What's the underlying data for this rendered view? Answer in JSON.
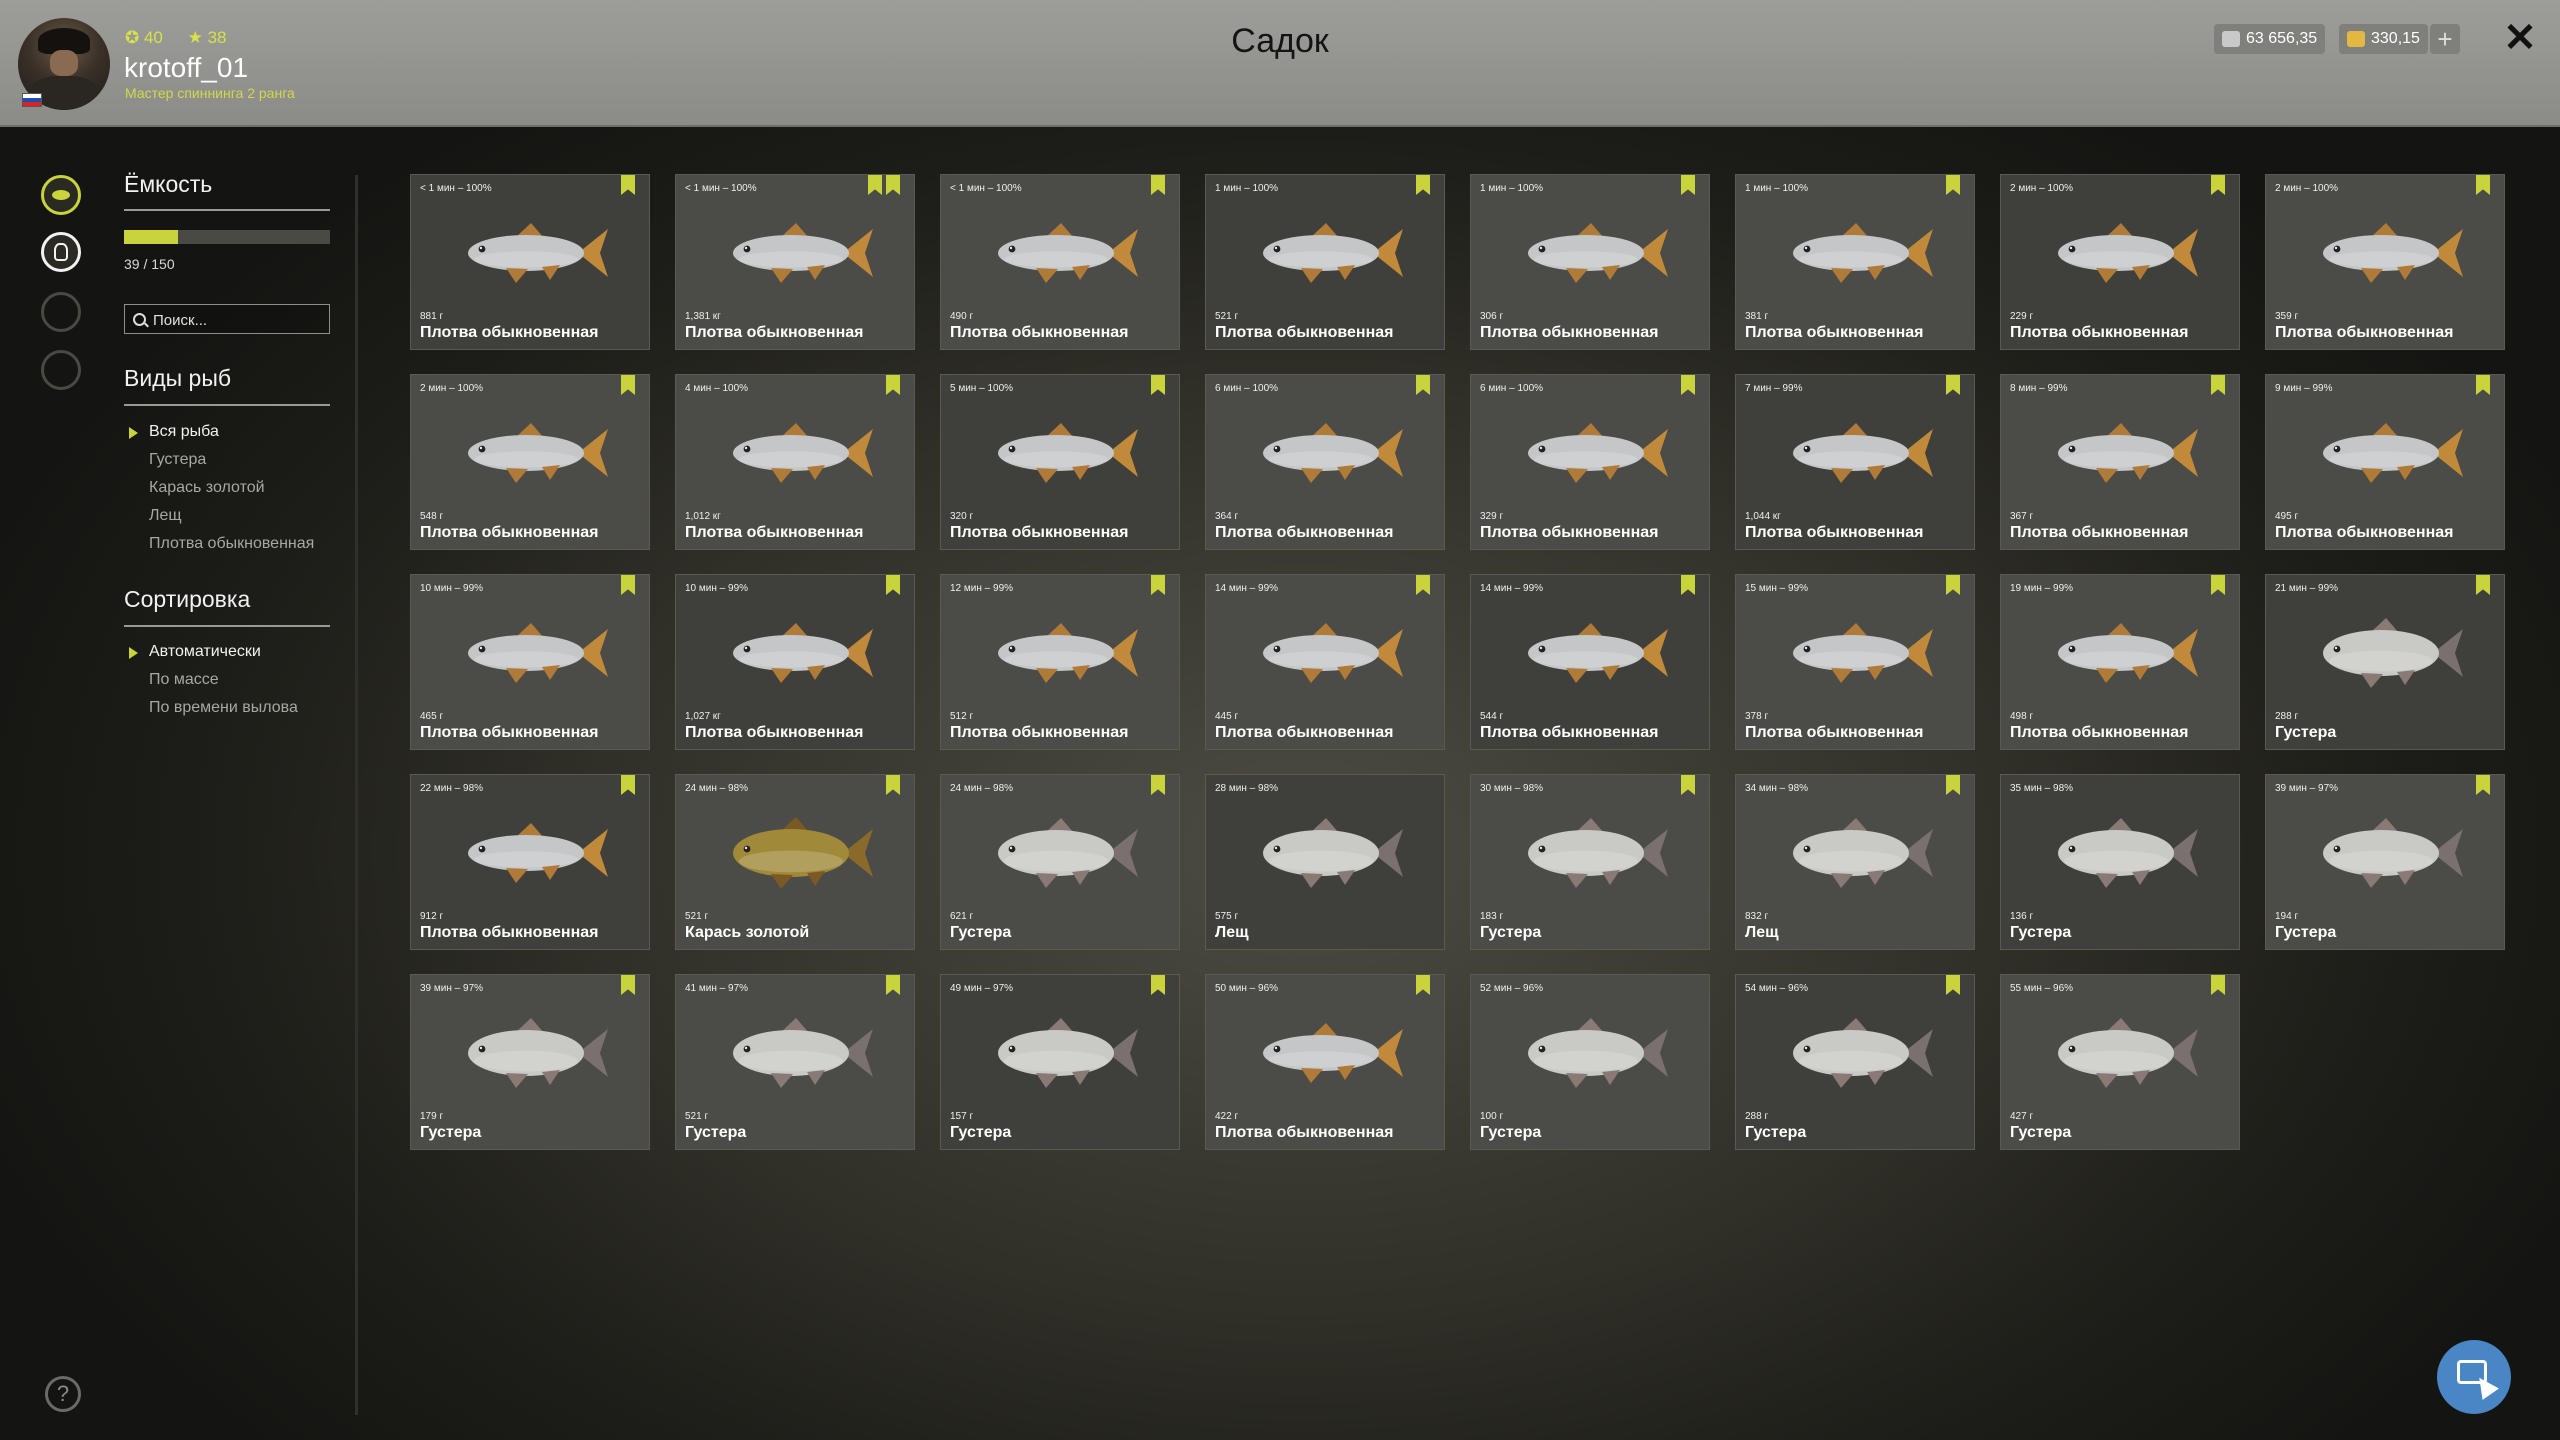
{
  "header": {
    "title": "Садок",
    "player": {
      "name": "krotoff_01",
      "rank": "Мастер спиннинга 2 ранга",
      "level": "40",
      "stars": "38"
    },
    "currency": {
      "silver": "63 656,35",
      "gold": "330,15"
    },
    "add_label": "+",
    "close_label": "✕"
  },
  "colors": {
    "accent": "#c9d33c",
    "header_bg": "#9d9d9a",
    "card_bg": "#4b4b47",
    "chat_button": "#4a86c5"
  },
  "sidebar": {
    "nav_icons": [
      "fish-icon",
      "keepnet-icon",
      "tent-icon",
      "home-icon"
    ],
    "capacity": {
      "heading": "Ёмкость",
      "current": 39,
      "max": 150,
      "text": "39 / 150"
    },
    "search": {
      "placeholder": "Поиск..."
    },
    "species": {
      "heading": "Виды рыб",
      "items": [
        "Вся рыба",
        "Густера",
        "Карась золотой",
        "Лещ",
        "Плотва обыкновенная"
      ],
      "active": 0
    },
    "sort": {
      "heading": "Сортировка",
      "items": [
        "Автоматически",
        "По массе",
        "По времени вылова"
      ],
      "active": 0
    },
    "help_label": "?"
  },
  "fish": [
    {
      "time": "< 1 мин – 100%",
      "weight": "881 г",
      "name": "Плотва обыкновенная",
      "marks": 1,
      "species": "roach"
    },
    {
      "time": "< 1 мин – 100%",
      "weight": "1,381 кг",
      "name": "Плотва обыкновенная",
      "marks": 2,
      "species": "roach"
    },
    {
      "time": "< 1 мин – 100%",
      "weight": "490 г",
      "name": "Плотва обыкновенная",
      "marks": 1,
      "species": "roach"
    },
    {
      "time": "1 мин – 100%",
      "weight": "521 г",
      "name": "Плотва обыкновенная",
      "marks": 1,
      "species": "roach"
    },
    {
      "time": "1 мин – 100%",
      "weight": "306 г",
      "name": "Плотва обыкновенная",
      "marks": 1,
      "species": "roach"
    },
    {
      "time": "1 мин – 100%",
      "weight": "381 г",
      "name": "Плотва обыкновенная",
      "marks": 1,
      "species": "roach"
    },
    {
      "time": "2 мин – 100%",
      "weight": "229 г",
      "name": "Плотва обыкновенная",
      "marks": 1,
      "species": "roach"
    },
    {
      "time": "2 мин – 100%",
      "weight": "359 г",
      "name": "Плотва обыкновенная",
      "marks": 1,
      "species": "roach"
    },
    {
      "time": "2 мин – 100%",
      "weight": "548 г",
      "name": "Плотва обыкновенная",
      "marks": 1,
      "species": "roach"
    },
    {
      "time": "4 мин – 100%",
      "weight": "1,012 кг",
      "name": "Плотва обыкновенная",
      "marks": 1,
      "species": "roach"
    },
    {
      "time": "5 мин – 100%",
      "weight": "320 г",
      "name": "Плотва обыкновенная",
      "marks": 1,
      "species": "roach"
    },
    {
      "time": "6 мин – 100%",
      "weight": "364 г",
      "name": "Плотва обыкновенная",
      "marks": 1,
      "species": "roach"
    },
    {
      "time": "6 мин – 100%",
      "weight": "329 г",
      "name": "Плотва обыкновенная",
      "marks": 1,
      "species": "roach"
    },
    {
      "time": "7 мин – 99%",
      "weight": "1,044 кг",
      "name": "Плотва обыкновенная",
      "marks": 1,
      "species": "roach"
    },
    {
      "time": "8 мин – 99%",
      "weight": "367 г",
      "name": "Плотва обыкновенная",
      "marks": 1,
      "species": "roach"
    },
    {
      "time": "9 мин – 99%",
      "weight": "495 г",
      "name": "Плотва обыкновенная",
      "marks": 1,
      "species": "roach"
    },
    {
      "time": "10 мин – 99%",
      "weight": "465 г",
      "name": "Плотва обыкновенная",
      "marks": 1,
      "species": "roach"
    },
    {
      "time": "10 мин – 99%",
      "weight": "1,027 кг",
      "name": "Плотва обыкновенная",
      "marks": 1,
      "species": "roach"
    },
    {
      "time": "12 мин – 99%",
      "weight": "512 г",
      "name": "Плотва обыкновенная",
      "marks": 1,
      "species": "roach"
    },
    {
      "time": "14 мин – 99%",
      "weight": "445 г",
      "name": "Плотва обыкновенная",
      "marks": 1,
      "species": "roach"
    },
    {
      "time": "14 мин – 99%",
      "weight": "544 г",
      "name": "Плотва обыкновенная",
      "marks": 1,
      "species": "roach"
    },
    {
      "time": "15 мин – 99%",
      "weight": "378 г",
      "name": "Плотва обыкновенная",
      "marks": 1,
      "species": "roach"
    },
    {
      "time": "19 мин – 99%",
      "weight": "498 г",
      "name": "Плотва обыкновенная",
      "marks": 1,
      "species": "roach"
    },
    {
      "time": "21 мин – 99%",
      "weight": "288 г",
      "name": "Густера",
      "marks": 1,
      "species": "bream"
    },
    {
      "time": "22 мин – 98%",
      "weight": "912 г",
      "name": "Плотва обыкновенная",
      "marks": 1,
      "species": "roach"
    },
    {
      "time": "24 мин – 98%",
      "weight": "521 г",
      "name": "Карась золотой",
      "marks": 1,
      "species": "carp"
    },
    {
      "time": "24 мин – 98%",
      "weight": "621 г",
      "name": "Густера",
      "marks": 1,
      "species": "bream"
    },
    {
      "time": "28 мин – 98%",
      "weight": "575 г",
      "name": "Лещ",
      "marks": 0,
      "species": "bream"
    },
    {
      "time": "30 мин – 98%",
      "weight": "183 г",
      "name": "Густера",
      "marks": 1,
      "species": "bream"
    },
    {
      "time": "34 мин – 98%",
      "weight": "832 г",
      "name": "Лещ",
      "marks": 1,
      "species": "bream"
    },
    {
      "time": "35 мин – 98%",
      "weight": "136 г",
      "name": "Густера",
      "marks": 0,
      "species": "bream"
    },
    {
      "time": "39 мин – 97%",
      "weight": "194 г",
      "name": "Густера",
      "marks": 1,
      "species": "bream"
    },
    {
      "time": "39 мин – 97%",
      "weight": "179 г",
      "name": "Густера",
      "marks": 1,
      "species": "bream"
    },
    {
      "time": "41 мин – 97%",
      "weight": "521 г",
      "name": "Густера",
      "marks": 1,
      "species": "bream"
    },
    {
      "time": "49 мин – 97%",
      "weight": "157 г",
      "name": "Густера",
      "marks": 1,
      "species": "bream"
    },
    {
      "time": "50 мин – 96%",
      "weight": "422 г",
      "name": "Плотва обыкновенная",
      "marks": 1,
      "species": "roach"
    },
    {
      "time": "52 мин – 96%",
      "weight": "100 г",
      "name": "Густера",
      "marks": 0,
      "species": "bream"
    },
    {
      "time": "54 мин – 96%",
      "weight": "288 г",
      "name": "Густера",
      "marks": 1,
      "species": "bream"
    },
    {
      "time": "55 мин – 96%",
      "weight": "427 г",
      "name": "Густера",
      "marks": 1,
      "species": "bream"
    }
  ],
  "chat_button": {
    "icon": "chat-cursor-icon"
  }
}
